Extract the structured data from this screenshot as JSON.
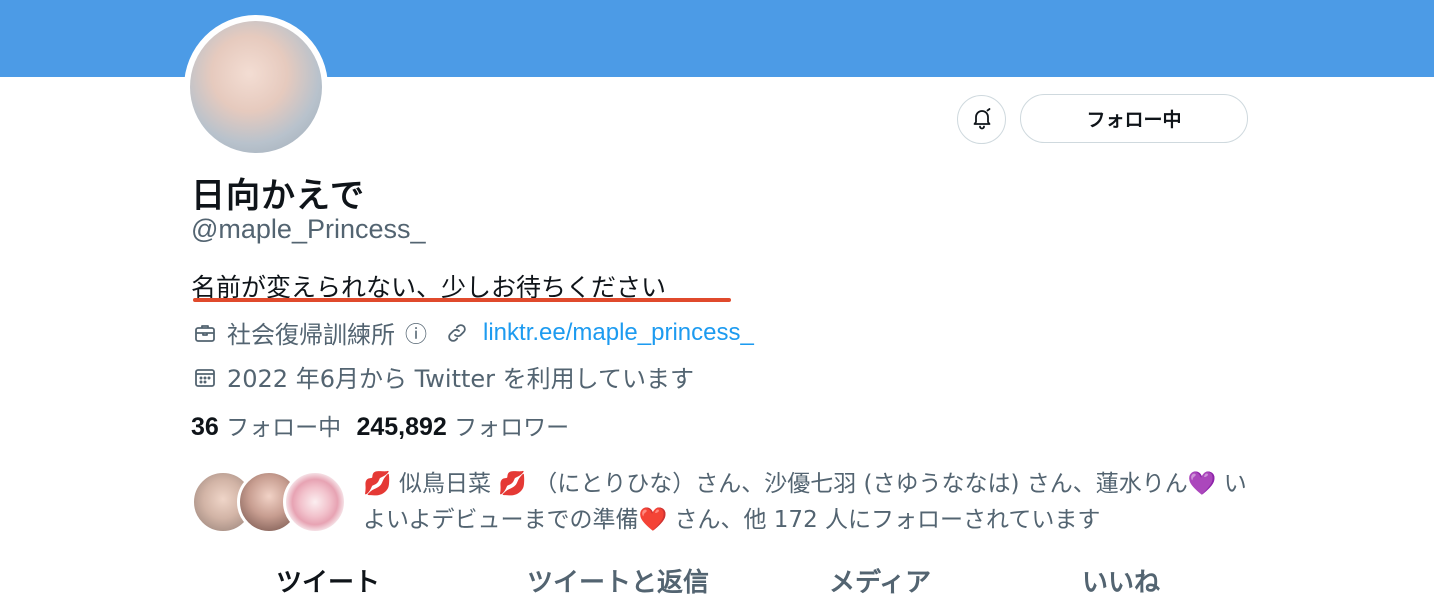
{
  "profile": {
    "display_name": "日向かえで",
    "handle": "@maple_Princess_",
    "bio": "名前が変えられない、少しお待ちください",
    "category": "社会復帰訓練所",
    "link": "linktr.ee/maple_princess_",
    "joined": "2022 年6月から Twitter を利用しています"
  },
  "actions": {
    "follow_label": "フォロー中",
    "notify_icon": "bell-icon"
  },
  "stats": {
    "following_count": "36",
    "following_label": "フォロー中",
    "followers_count": "245,892",
    "followers_label": "フォロワー"
  },
  "followers_you_know": {
    "text": "💋 似鳥日菜 💋 （にとりひな）さん、沙優七羽 (さゆうななは) さん、蓮水りん💜 いよいよデビューまでの準備❤️ さん、他 172 人にフォローされています"
  },
  "tabs": [
    {
      "label": "ツイート"
    },
    {
      "label": "ツイートと返信"
    },
    {
      "label": "メディア"
    },
    {
      "label": "いいね"
    }
  ],
  "colors": {
    "banner": "#4c9be6",
    "link": "#1d9bf0",
    "underline": "#e04a2c"
  }
}
